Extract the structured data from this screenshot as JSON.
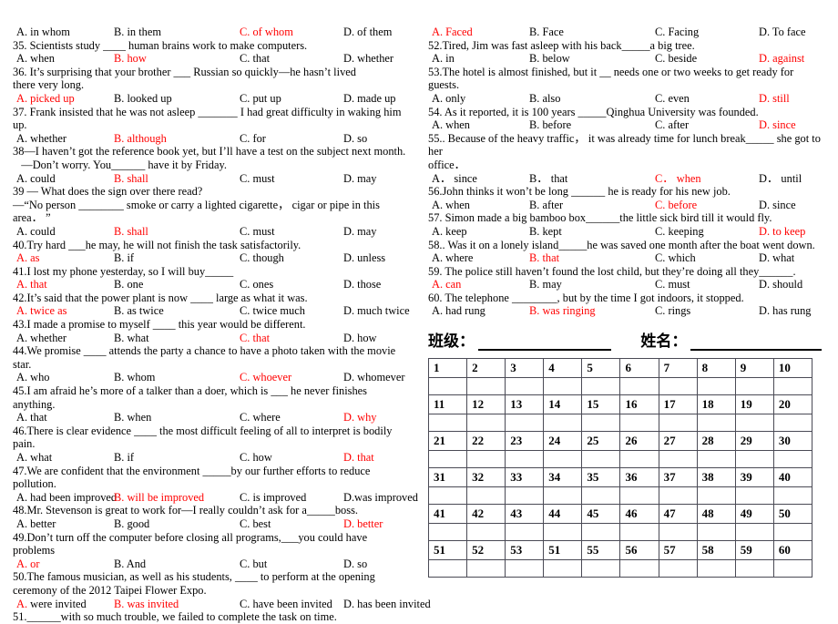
{
  "document": {
    "type": "english-grammar-multiple-choice-worksheet",
    "colors": {
      "answer_key_red": "#ff0000",
      "text_black": "#000000",
      "table_border": "#4a4a55"
    }
  },
  "left_column": {
    "blocks": [
      {
        "kind": "options",
        "items": [
          {
            "label": "A. in whom",
            "red": false
          },
          {
            "label": "B. in them",
            "red": false
          },
          {
            "label": "C. of whom",
            "red": true
          },
          {
            "label": "D. of them",
            "red": false
          }
        ]
      },
      {
        "kind": "stem",
        "lines": [
          "35. Scientists study ____ human brains work to make computers."
        ]
      },
      {
        "kind": "options",
        "items": [
          {
            "label": "A. when",
            "red": false
          },
          {
            "label": "B. how",
            "red": true
          },
          {
            "label": "C. that",
            "red": false
          },
          {
            "label": "D. whether",
            "red": false
          }
        ]
      },
      {
        "kind": "stem",
        "justify": true,
        "lines": [
          "36. It’s surprising that your brother ___ Russian so quickly—he hasn’t lived",
          "there very long."
        ]
      },
      {
        "kind": "options",
        "items": [
          {
            "label": "A. picked up",
            "red": true
          },
          {
            "label": "B. looked up",
            "red": false
          },
          {
            "label": "C. put up",
            "red": false
          },
          {
            "label": "D. made up",
            "red": false
          }
        ]
      },
      {
        "kind": "stem",
        "lines": [
          "37. Frank insisted that he was not asleep _______ I had great difficulty in waking him up."
        ]
      },
      {
        "kind": "options",
        "items": [
          {
            "label": "A. whether",
            "red": false
          },
          {
            "label": "B. although",
            "red": true
          },
          {
            "label": "C. for",
            "red": false
          },
          {
            "label": "D. so",
            "red": false
          }
        ]
      },
      {
        "kind": "stem",
        "lines": [
          "38—I haven’t got the reference book yet, but I’ll have a test on the subject next month.",
          "   —Don’t worry. You______ have it by Friday."
        ]
      },
      {
        "kind": "options",
        "items": [
          {
            "label": "A. could",
            "red": false
          },
          {
            "label": "B. shall",
            "red": true
          },
          {
            "label": "C. must",
            "red": false
          },
          {
            "label": "D. may",
            "red": false
          }
        ]
      },
      {
        "kind": "stem",
        "lines": [
          "39 — What does the sign over there read?",
          "—“No person ________ smoke or carry a lighted cigarette， cigar or pipe in this area． ”"
        ]
      },
      {
        "kind": "options",
        "items": [
          {
            "label": "A. could",
            "red": false
          },
          {
            "label": "B. shall",
            "red": true
          },
          {
            "label": "C. must",
            "red": false
          },
          {
            "label": "D. may",
            "red": false
          }
        ]
      },
      {
        "kind": "stem",
        "lines": [
          "40.Try hard ___he may, he will not finish the task satisfactorily."
        ]
      },
      {
        "kind": "options",
        "items": [
          {
            "label": "A. as",
            "red": true
          },
          {
            "label": "B. if",
            "red": false
          },
          {
            "label": "C. though",
            "red": false
          },
          {
            "label": "D. unless",
            "red": false
          }
        ]
      },
      {
        "kind": "stem",
        "lines": [
          "41.I lost my phone yesterday, so I will buy_____"
        ]
      },
      {
        "kind": "options",
        "items": [
          {
            "label": "A. that",
            "red": true
          },
          {
            "label": "B. one",
            "red": false
          },
          {
            "label": "C. ones",
            "red": false
          },
          {
            "label": "D. those",
            "red": false
          }
        ]
      },
      {
        "kind": "stem",
        "lines": [
          "42.It’s said that the power plant is now ____ large as what it was."
        ]
      },
      {
        "kind": "options",
        "items": [
          {
            "label": "A. twice as",
            "red": true
          },
          {
            "label": "B. as twice",
            "red": false
          },
          {
            "label": "C. twice much",
            "red": false
          },
          {
            "label": "D. much twice",
            "red": false
          }
        ]
      },
      {
        "kind": "stem",
        "lines": [
          "43.I made a promise to myself ____ this year would be different."
        ]
      },
      {
        "kind": "options",
        "items": [
          {
            "label": "A. whether",
            "red": false
          },
          {
            "label": "B. what",
            "red": false
          },
          {
            "label": "C. that",
            "red": true
          },
          {
            "label": "D. how",
            "red": false
          }
        ]
      },
      {
        "kind": "stem",
        "justify": true,
        "lines": [
          "44.We promise ____ attends the party a chance to have a photo taken with the movie",
          "star."
        ]
      },
      {
        "kind": "options",
        "items": [
          {
            "label": "A. who",
            "red": false
          },
          {
            "label": "B. whom",
            "red": false
          },
          {
            "label": "C. whoever",
            "red": true
          },
          {
            "label": "D. whomever",
            "red": false
          }
        ]
      },
      {
        "kind": "stem",
        "lines": [
          "45.I am afraid he’s more of a talker than a doer, which is ___ he never finishes anything."
        ]
      },
      {
        "kind": "options",
        "items": [
          {
            "label": "A. that",
            "red": false
          },
          {
            "label": "B. when",
            "red": false
          },
          {
            "label": "C. where",
            "red": false
          },
          {
            "label": "D. why",
            "red": true
          }
        ]
      },
      {
        "kind": "stem",
        "lines": [
          "46.There is clear evidence ____ the most difficult feeling of all to interpret is bodily pain."
        ]
      },
      {
        "kind": "options",
        "items": [
          {
            "label": "A. what",
            "red": false
          },
          {
            "label": "B. if",
            "red": false
          },
          {
            "label": "C. how",
            "red": false
          },
          {
            "label": "D. that",
            "red": true
          }
        ]
      },
      {
        "kind": "stem",
        "justify": true,
        "lines": [
          "47.We are confident that the environment _____by our further efforts to reduce",
          "pollution."
        ]
      },
      {
        "kind": "options",
        "items": [
          {
            "label": "A. had been improved",
            "red": false
          },
          {
            "label": "B. will be improved",
            "red": true
          },
          {
            "label": "C. is improved",
            "red": false
          },
          {
            "label": "D.was improved",
            "red": false
          }
        ]
      },
      {
        "kind": "stem",
        "lines": [
          "48.Mr. Stevenson is great to work for—I really couldn’t ask for a_____boss."
        ]
      },
      {
        "kind": "options",
        "items": [
          {
            "label": "A. better",
            "red": false
          },
          {
            "label": "B. good",
            "red": false
          },
          {
            "label": "C. best",
            "red": false
          },
          {
            "label": "D. better",
            "red": true
          }
        ]
      },
      {
        "kind": "stem",
        "lines": [
          "49.Don’t turn off the computer before closing all programs,___you could have problems"
        ]
      },
      {
        "kind": "options",
        "items": [
          {
            "label": "A. or",
            "red": true
          },
          {
            "label": "B. And",
            "red": false
          },
          {
            "label": "C. but",
            "red": false
          },
          {
            "label": "D. so",
            "red": false
          }
        ]
      },
      {
        "kind": "stem",
        "justify": true,
        "lines": [
          "50.The famous musician, as well as his students, ____ to perform at the opening",
          "ceremony of the 2012 Taipei Flower Expo."
        ]
      },
      {
        "kind": "options",
        "items": [
          {
            "label": "A.",
            "tail": " were invited",
            "red": true
          },
          {
            "label": "B. was invited",
            "red": true
          },
          {
            "label": "C. have been invited",
            "red": false
          },
          {
            "label": "D. has been invited",
            "red": false
          }
        ]
      },
      {
        "kind": "stem",
        "lines": [
          "51.______with so much trouble, we failed to complete the task on time."
        ]
      }
    ]
  },
  "right_column": {
    "blocks": [
      {
        "kind": "options",
        "items": [
          {
            "label": "A. Faced",
            "red": true
          },
          {
            "label": "B. Face",
            "red": false
          },
          {
            "label": "C. Facing",
            "red": false
          },
          {
            "label": "D. To face",
            "red": false
          }
        ]
      },
      {
        "kind": "stem",
        "lines": [
          "52.Tired, Jim was fast asleep with his back_____a big tree."
        ]
      },
      {
        "kind": "options",
        "items": [
          {
            "label": "A. in",
            "red": false
          },
          {
            "label": "B. below",
            "red": false
          },
          {
            "label": "C. beside",
            "red": false
          },
          {
            "label": "D. against",
            "red": true
          }
        ]
      },
      {
        "kind": "stem",
        "lines": [
          "53.The hotel is almost finished, but it __ needs one or two weeks to get ready for guests."
        ]
      },
      {
        "kind": "options",
        "items": [
          {
            "label": "A. only",
            "red": false
          },
          {
            "label": "B. also",
            "red": false
          },
          {
            "label": "C. even",
            "red": false
          },
          {
            "label": "D. still",
            "red": true
          }
        ]
      },
      {
        "kind": "stem",
        "lines": [
          "54. As it reported, it is 100 years _____Qinghua University was founded."
        ]
      },
      {
        "kind": "options",
        "items": [
          {
            "label": "A. when",
            "red": false
          },
          {
            "label": "B. before",
            "red": false
          },
          {
            "label": "C. after",
            "red": false
          },
          {
            "label": "D. since",
            "red": true
          }
        ]
      },
      {
        "kind": "stem",
        "lines": [
          "55.. Because of the heavy traffic， it was already time for lunch break_____ she got to her",
          "office．"
        ]
      },
      {
        "kind": "options",
        "items": [
          {
            "label": "A． since",
            "red": false
          },
          {
            "label": "B． that",
            "red": false
          },
          {
            "label": "C． when",
            "red": true
          },
          {
            "label": "D． until",
            "red": false
          }
        ]
      },
      {
        "kind": "stem",
        "lines": [
          "56.John thinks it won’t be long ______ he is ready for his new job."
        ]
      },
      {
        "kind": "options",
        "items": [
          {
            "label": "A. when",
            "red": false
          },
          {
            "label": "B. after",
            "red": false
          },
          {
            "label": "C. before",
            "red": true
          },
          {
            "label": "D. since",
            "red": false
          }
        ]
      },
      {
        "kind": "stem",
        "lines": [
          "57. Simon made a big bamboo box______the little sick bird till it would fly."
        ]
      },
      {
        "kind": "options",
        "items": [
          {
            "label": "A. keep",
            "red": false
          },
          {
            "label": "B. kept",
            "red": false
          },
          {
            "label": "C. keeping",
            "red": false
          },
          {
            "label": "D. to keep",
            "red": true
          }
        ]
      },
      {
        "kind": "stem",
        "lines": [
          "58.. Was it on a lonely island_____he was saved one month after the boat went down."
        ]
      },
      {
        "kind": "options",
        "items": [
          {
            "label": "A. where",
            "red": false
          },
          {
            "label": "B. that",
            "red": true
          },
          {
            "label": "C. which",
            "red": false
          },
          {
            "label": "D. what",
            "red": false
          }
        ]
      },
      {
        "kind": "stem",
        "lines": [
          "59. The police still haven’t found the lost child, but they’re doing all they______."
        ]
      },
      {
        "kind": "options",
        "items": [
          {
            "label": "A. can",
            "red": true
          },
          {
            "label": "B. may",
            "red": false
          },
          {
            "label": "C. must",
            "red": false
          },
          {
            "label": "D. should",
            "red": false
          }
        ]
      },
      {
        "kind": "stem",
        "lines": [
          "60. The telephone ________, but by the time I got indoors, it stopped."
        ]
      },
      {
        "kind": "options",
        "items": [
          {
            "label": "A. had rung",
            "red": false
          },
          {
            "label": "B. was ringing",
            "red": true
          },
          {
            "label": "C. rings",
            "red": false
          },
          {
            "label": "D. has rung",
            "red": false
          }
        ]
      }
    ],
    "id_fields": {
      "class_label": "班级：",
      "name_label": "姓名："
    },
    "answer_table": {
      "rows": [
        [
          "1",
          "2",
          "3",
          "4",
          "5",
          "6",
          "7",
          "8",
          "9",
          "10"
        ],
        [
          "11",
          "12",
          "13",
          "14",
          "15",
          "16",
          "17",
          "18",
          "19",
          "20"
        ],
        [
          "21",
          "22",
          "23",
          "24",
          "25",
          "26",
          "27",
          "28",
          "29",
          "30"
        ],
        [
          "31",
          "32",
          "33",
          "34",
          "35",
          "36",
          "37",
          "38",
          "39",
          "40"
        ],
        [
          "41",
          "42",
          "43",
          "44",
          "45",
          "46",
          "47",
          "48",
          "49",
          "50"
        ],
        [
          "51",
          "52",
          "53",
          "51",
          "55",
          "56",
          "57",
          "58",
          "59",
          "60"
        ]
      ]
    }
  }
}
